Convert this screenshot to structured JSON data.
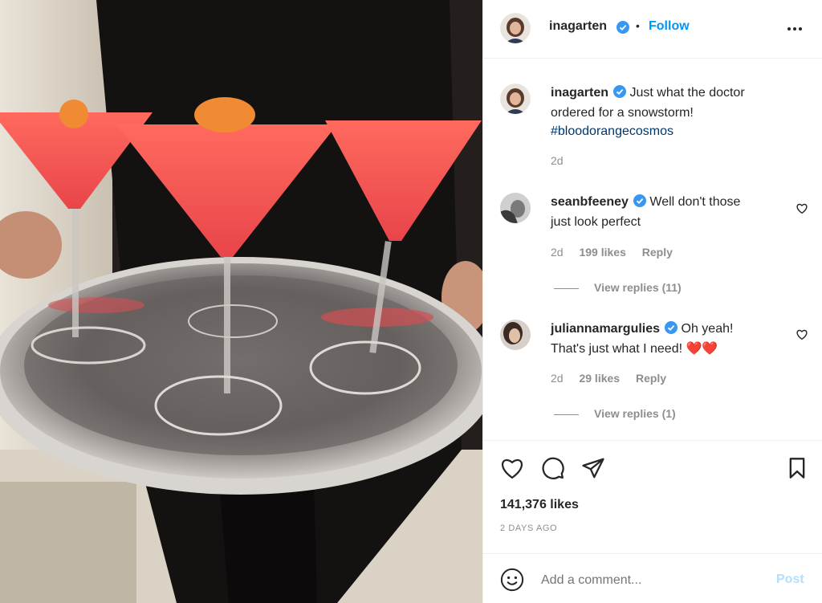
{
  "post": {
    "author": "inagarten",
    "follow_label": "Follow",
    "separator": "•",
    "caption": {
      "author": "inagarten",
      "text_line1": "Just what the doctor",
      "text_line2": "ordered for a snowstorm!",
      "hashtag": "#bloodorangecosmos",
      "time": "2d"
    },
    "likes": "141,376 likes",
    "date": "2 DAYS AGO"
  },
  "comments": [
    {
      "author": "seanbfeeney",
      "text_line1": "Well don't those",
      "text_line2": "just look perfect",
      "time": "2d",
      "likes": "199 likes",
      "reply_label": "Reply",
      "view_replies": "View replies (11)"
    },
    {
      "author": "juliannamargulies",
      "text_line1": "Oh yeah!",
      "text_line2": "That's just what I need! ❤️❤️",
      "time": "2d",
      "likes": "29 likes",
      "reply_label": "Reply",
      "view_replies": "View replies (1)"
    }
  ],
  "composer": {
    "placeholder": "Add a comment...",
    "post_label": "Post"
  },
  "icons": {
    "more": "more-options-icon",
    "like": "heart-icon",
    "comment": "comment-icon",
    "share": "share-icon",
    "save": "bookmark-icon",
    "emoji": "emoji-icon",
    "verified": "verified-badge-icon"
  },
  "colors": {
    "link_blue": "#0095f6",
    "hashtag": "#00376b",
    "secondary_text": "#8e8e8e",
    "post_disabled": "#b2dffc",
    "verified": "#3897f0"
  }
}
